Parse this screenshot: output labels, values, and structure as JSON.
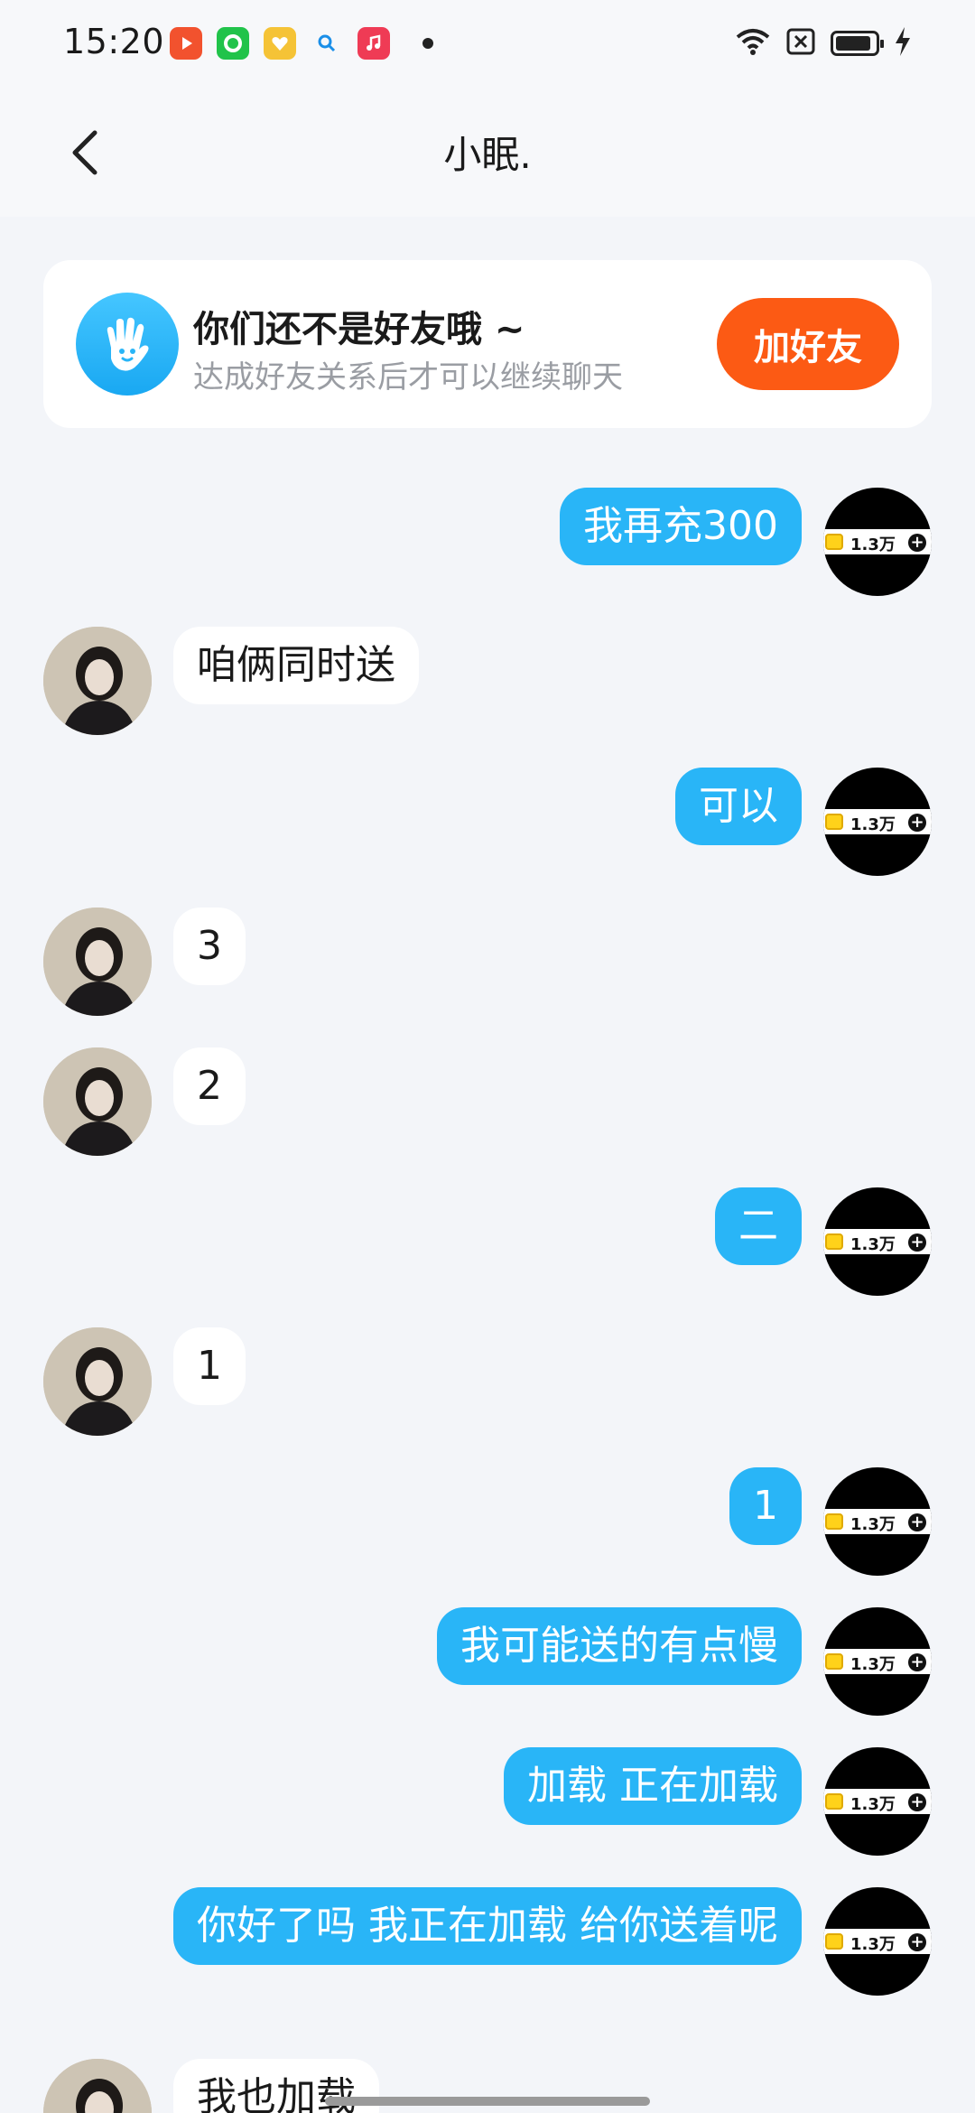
{
  "status_bar": {
    "time": "15:20",
    "apps": [
      {
        "icon": "video-app-icon",
        "color": "#f2522e"
      },
      {
        "icon": "camera-app-icon",
        "color": "#21c34a"
      },
      {
        "icon": "heart-app-icon",
        "color": "#f5c336"
      },
      {
        "icon": "search-app-icon",
        "color": "#ffffff"
      },
      {
        "icon": "music-app-icon",
        "color": "#ef3b55"
      }
    ],
    "icons": [
      "wifi-icon",
      "sim-off-icon",
      "battery-icon",
      "charging-icon"
    ],
    "battery_level": 0.8
  },
  "header": {
    "title": "小眠."
  },
  "friend_card": {
    "title": "你们还不是好友哦 ~",
    "subtitle": "达成好友关系后才可以继续聊天",
    "button": "加好友"
  },
  "self_badge": {
    "count": "1.3万"
  },
  "messages": [
    {
      "from": "self",
      "text": "我再充300"
    },
    {
      "from": "other",
      "text": "咱俩同时送"
    },
    {
      "from": "self",
      "text": "可以"
    },
    {
      "from": "other",
      "text": "3"
    },
    {
      "from": "other",
      "text": "2"
    },
    {
      "from": "self",
      "text": "二"
    },
    {
      "from": "other",
      "text": "1"
    },
    {
      "from": "self",
      "text": "1"
    },
    {
      "from": "self",
      "text": "我可能送的有点慢"
    },
    {
      "from": "self",
      "text": "加载 正在加载"
    },
    {
      "from": "self",
      "text": "你好了吗 我正在加载 给你送着呢"
    },
    {
      "from": "other",
      "text": "我也加载"
    }
  ],
  "colors": {
    "self_bubble": "#29b5f7",
    "other_bubble": "#ffffff",
    "add_friend_button": "#fc5a14",
    "background": "#f3f5f9"
  }
}
